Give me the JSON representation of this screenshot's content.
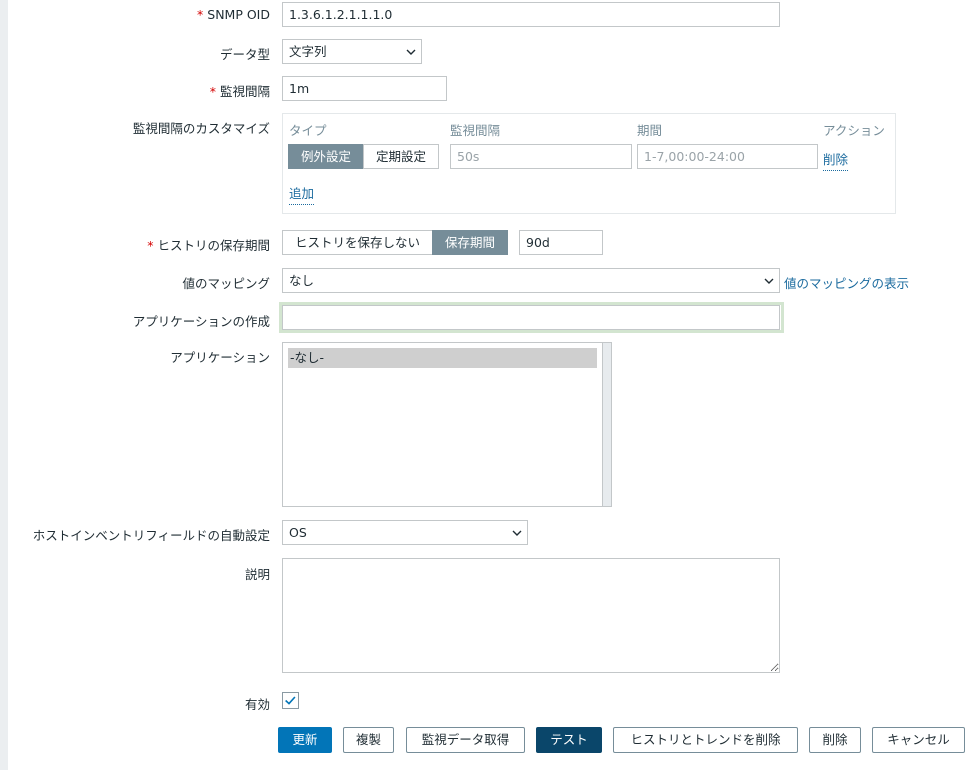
{
  "fields": {
    "snmp_oid": {
      "label": "SNMP OID",
      "value": "1.3.6.1.2.1.1.1.0"
    },
    "data_type": {
      "label": "データ型",
      "value": "文字列"
    },
    "interval": {
      "label": "監視間隔",
      "value": "1m"
    },
    "custom_intervals": {
      "label": "監視間隔のカスタマイズ",
      "headers": {
        "type": "タイプ",
        "interval": "監視間隔",
        "period": "期間",
        "action": "アクション"
      },
      "type_options": [
        "例外設定",
        "定期設定"
      ],
      "interval_placeholder": "50s",
      "period_placeholder": "1-7,00:00-24:00",
      "remove": "削除",
      "add": "追加"
    },
    "history": {
      "label": "ヒストリの保存期間",
      "options": [
        "ヒストリを保存しない",
        "保存期間"
      ],
      "value": "90d"
    },
    "valuemap": {
      "label": "値のマッピング",
      "value": "なし",
      "link": "値のマッピングの表示"
    },
    "new_application": {
      "label": "アプリケーションの作成",
      "value": ""
    },
    "applications": {
      "label": "アプリケーション",
      "items": [
        "-なし-"
      ]
    },
    "inventory": {
      "label": "ホストインベントリフィールドの自動設定",
      "value": "OS"
    },
    "description": {
      "label": "説明",
      "value": ""
    },
    "enabled": {
      "label": "有効",
      "checked": true
    }
  },
  "buttons": {
    "update": "更新",
    "clone": "複製",
    "get_value": "監視データ取得",
    "test": "テスト",
    "clear": "ヒストリとトレンドを削除",
    "delete": "削除",
    "cancel": "キャンセル"
  }
}
